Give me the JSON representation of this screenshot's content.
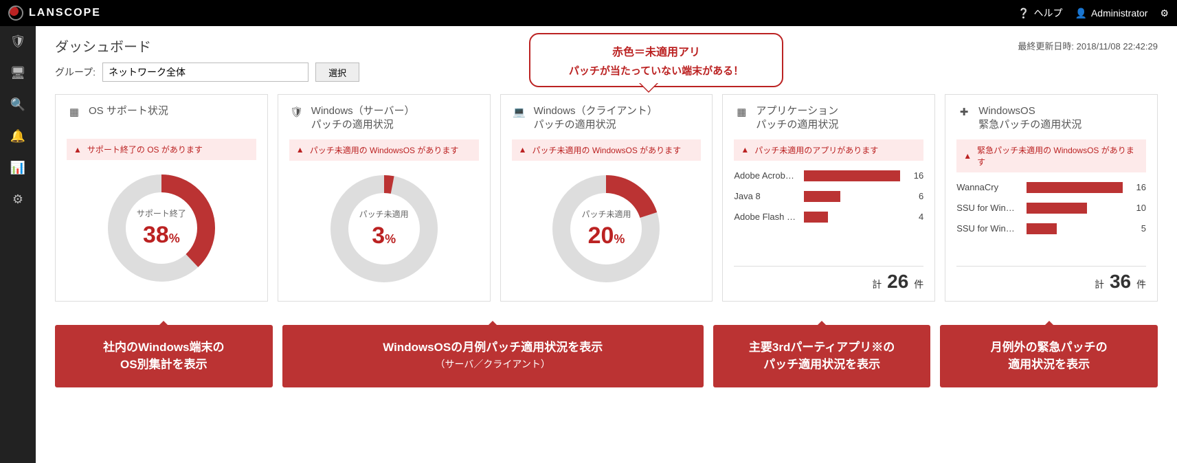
{
  "brand": "LANSCOPE",
  "topbar": {
    "help": "ヘルプ",
    "user": "Administrator"
  },
  "page": {
    "title": "ダッシュボード",
    "updated_label": "最終更新日時:",
    "updated_value": "2018/11/08 22:42:29",
    "group_label": "グループ:",
    "group_value": "ネットワーク全体",
    "select_button": "選択"
  },
  "bubble": {
    "line1": "赤色＝未適用アリ",
    "line2": "パッチが当たっていない端末がある！"
  },
  "cards": {
    "os": {
      "title": "OS サポート状況",
      "alert": "サポート終了の OS があります",
      "center_label": "サポート終了",
      "value": 38
    },
    "server": {
      "title_line1": "Windows（サーバー）",
      "title_line2": "パッチの適用状況",
      "alert": "パッチ未適用の WindowsOS があります",
      "center_label": "パッチ未適用",
      "value": 3
    },
    "client": {
      "title_line1": "Windows（クライアント）",
      "title_line2": "パッチの適用状況",
      "alert": "パッチ未適用の WindowsOS があります",
      "center_label": "パッチ未適用",
      "value": 20
    },
    "app": {
      "title_line1": "アプリケーション",
      "title_line2": "パッチの適用状況",
      "alert": "パッチ未適用のアプリがあります",
      "total_prefix": "計",
      "total_value": 26,
      "total_suffix": "件"
    },
    "emergency": {
      "title_line1": "WindowsOS",
      "title_line2": "緊急パッチの適用状況",
      "alert": "緊急パッチ未適用の WindowsOS があります",
      "total_prefix": "計",
      "total_value": 36,
      "total_suffix": "件"
    }
  },
  "chart_data": [
    {
      "type": "pie",
      "card": "os",
      "title": "サポート終了",
      "values": [
        38,
        62
      ],
      "unit": "%"
    },
    {
      "type": "pie",
      "card": "server",
      "title": "パッチ未適用",
      "values": [
        3,
        97
      ],
      "unit": "%"
    },
    {
      "type": "pie",
      "card": "client",
      "title": "パッチ未適用",
      "values": [
        20,
        80
      ],
      "unit": "%"
    },
    {
      "type": "bar",
      "card": "app",
      "max": 16,
      "categories": [
        "Adobe Acrob…",
        "Java 8",
        "Adobe Flash …"
      ],
      "values": [
        16,
        6,
        4
      ]
    },
    {
      "type": "bar",
      "card": "emergency",
      "max": 16,
      "categories": [
        "WannaCry",
        "SSU for Win…",
        "SSU for Win…"
      ],
      "values": [
        16,
        10,
        5
      ]
    }
  ],
  "callouts": {
    "c1_line1": "社内のWindows端末の",
    "c1_line2": "OS別集計を表示",
    "c2_line1": "WindowsOSの月例パッチ適用状況を表示",
    "c2_sub": "（サーバ／クライアント）",
    "c3_line1": "主要3rdパーティアプリ※の",
    "c3_line2": "パッチ適用状況を表示",
    "c4_line1": "月例外の緊急パッチの",
    "c4_line2": "適用状況を表示"
  }
}
